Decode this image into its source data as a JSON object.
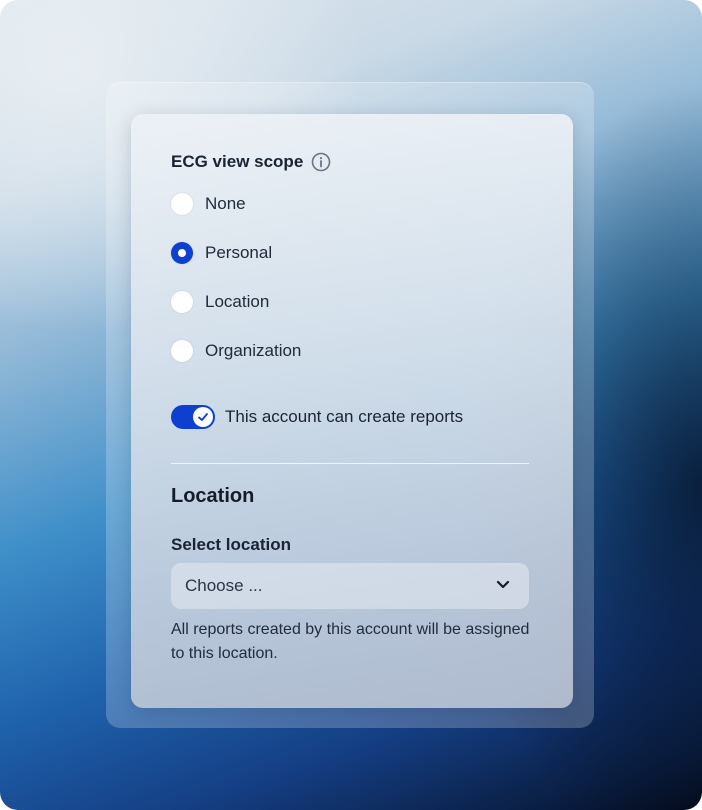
{
  "ecg_scope": {
    "title": "ECG view scope",
    "info_icon": "info-circle-icon",
    "options": [
      {
        "label": "None",
        "checked": false
      },
      {
        "label": "Personal",
        "checked": true
      },
      {
        "label": "Location",
        "checked": false
      },
      {
        "label": "Organization",
        "checked": false
      }
    ]
  },
  "create_reports": {
    "label": "This account can create reports",
    "enabled": true,
    "icon": "checkmark-icon"
  },
  "location": {
    "section_title": "Location",
    "field_label": "Select location",
    "select_value": "Choose ...",
    "select_icon": "chevron-down-icon",
    "help_text": "All reports created by this account will be assigned to this location."
  },
  "colors": {
    "accent": "#0f3fd0",
    "text_primary": "#1a2333"
  }
}
